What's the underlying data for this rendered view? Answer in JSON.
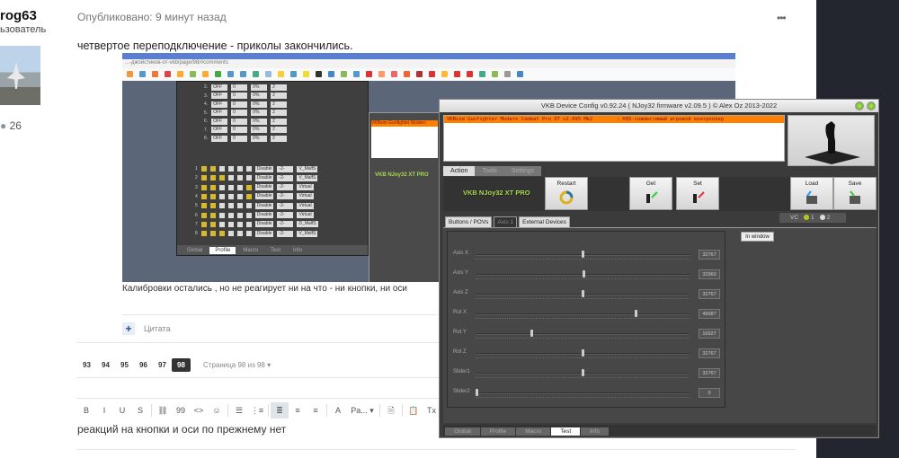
{
  "forum": {
    "username": "rog63",
    "role": "ьзователь",
    "post_count": "26",
    "post_date": "Опубликовано: 9 минут назад",
    "more_icon": "•••",
    "post_text": "четвертое переподключение - приколы закончились.",
    "caption": "Калибровки остались , но не реагирует ни на что - ни кнопки, ни оси",
    "quote_plus": "+",
    "quote_label": "Цитата",
    "pages": [
      "93",
      "94",
      "95",
      "96",
      "97",
      "98"
    ],
    "current_page": "98",
    "page_info": "Страница 98 из 98 ▾",
    "editor_tools": [
      "B",
      "I",
      "U",
      "S",
      "⛓",
      "99",
      "<>",
      "☺",
      "☰",
      "⋮≡",
      "≣",
      "≡",
      "≡",
      "A",
      "Pa... ▾",
      "🗎",
      "📋",
      "Tx"
    ],
    "editor_text": "реакций на кнопки и оси по прежнему нет"
  },
  "embedded": {
    "url": "...-джойстиков-от-vkb/page/98/#comments",
    "old_rows": [
      {
        "n": "2.",
        "a": "OFF",
        "b": "0",
        "c": "0%",
        "d": "2"
      },
      {
        "n": "3.",
        "a": "OFF",
        "b": "0",
        "c": "0%",
        "d": "2"
      },
      {
        "n": "4.",
        "a": "OFF",
        "b": "0",
        "c": "0%",
        "d": "2"
      },
      {
        "n": "5.",
        "a": "OFF",
        "b": "0",
        "c": "0%",
        "d": "2"
      },
      {
        "n": "6.",
        "a": "OFF",
        "b": "0",
        "c": "0%",
        "d": "2"
      },
      {
        "n": "7.",
        "a": "OFF",
        "b": "0",
        "c": "0%",
        "d": "2"
      },
      {
        "n": "8.",
        "a": "OFF",
        "b": "0",
        "c": "0%",
        "d": "2"
      }
    ],
    "axis_rows": [
      {
        "n": "1",
        "trim": "Disable",
        "mode": "-2-",
        "input": "V_MalfS"
      },
      {
        "n": "2",
        "trim": "Disable",
        "mode": "-2-",
        "input": "V_MalfS"
      },
      {
        "n": "3",
        "trim": "Disable",
        "mode": "-2-",
        "input": "Virtual"
      },
      {
        "n": "4",
        "trim": "Disable",
        "mode": "-2-",
        "input": "Virtual"
      },
      {
        "n": "5",
        "trim": "Disable",
        "mode": "-2-",
        "input": "Virtual"
      },
      {
        "n": "6",
        "trim": "Disable",
        "mode": "-2-",
        "input": "Virtual"
      },
      {
        "n": "7",
        "trim": "Disable",
        "mode": "-2-",
        "input": "D_MalfS"
      },
      {
        "n": "8",
        "trim": "Disable",
        "mode": "-2-",
        "input": "V_MalfS"
      }
    ],
    "old_tabs": [
      "Global",
      "Profile",
      "Macro",
      "Test",
      "Info"
    ],
    "old_active_tab": "Profile",
    "mid_device": "VKBsim Gunfighter Modern",
    "mid_name": "VKB NJoy32 XT PRO"
  },
  "vkb": {
    "title": "VKB Device Config v0.92.24 ( NJoy32 firmware v2.09.5 ) © Alex Oz 2013-2022",
    "device_row": "VKBsim Gunfighter Modern Combat Pro XT v2.095 Mk2        : HID-совместимый игровой контроллер",
    "tabs": [
      "Action",
      "Tools",
      "Settings"
    ],
    "active_tab": "Action",
    "device_name": "VKB NJoy32 XT PRO",
    "buttons": {
      "restart": "Restart",
      "get": "Get",
      "set": "Set",
      "load": "Load",
      "save": "Save"
    },
    "vc_label": "VC",
    "vc_options": [
      "1",
      "2"
    ],
    "vc_selected": "1",
    "subtabs": [
      "Buttons / POVs",
      "Axis 1",
      "External Devices"
    ],
    "active_subtab": "Axis 1",
    "in_window": "In window",
    "axis_max": 65535,
    "axes": [
      {
        "label": "Axis X",
        "value": 32767
      },
      {
        "label": "Axis Y",
        "value": 32960
      },
      {
        "label": "Axis Z",
        "value": 32767
      },
      {
        "label": "Rot X",
        "value": 49087
      },
      {
        "label": "Rot Y",
        "value": 16927
      },
      {
        "label": "Rot Z",
        "value": 32767
      },
      {
        "label": "Slider1",
        "value": 32767
      },
      {
        "label": "Slider2",
        "value": 0
      }
    ],
    "bottom_tabs": [
      "Global",
      "Profile",
      "Macro",
      "Test",
      "Info"
    ],
    "active_bottom_tab": "Test"
  }
}
